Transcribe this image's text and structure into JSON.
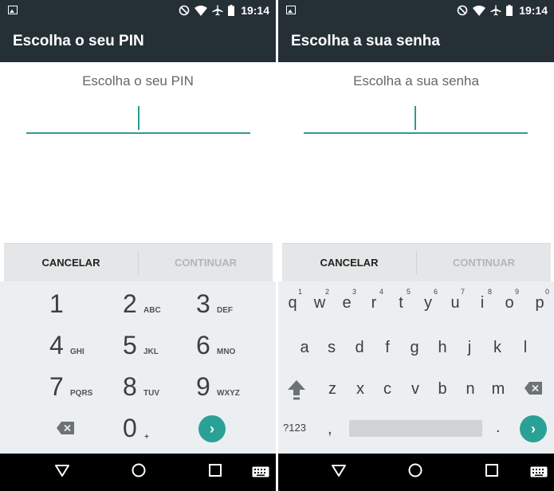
{
  "status_bar": {
    "time": "19:14",
    "icons": [
      "image-icon",
      "do-not-disturb-icon",
      "wifi-icon",
      "airplane-icon",
      "battery-icon"
    ]
  },
  "colors": {
    "bar": "#253036",
    "accent": "#2a9d8f",
    "keyboard": "#eceff1"
  },
  "left": {
    "title": "Escolha o seu PIN",
    "prompt": "Escolha o seu PIN",
    "cancel_label": "CANCELAR",
    "continue_label": "CONTINUAR",
    "numpad": [
      {
        "digit": "1",
        "letters": ""
      },
      {
        "digit": "2",
        "letters": "ABC"
      },
      {
        "digit": "3",
        "letters": "DEF"
      },
      {
        "digit": "4",
        "letters": "GHI"
      },
      {
        "digit": "5",
        "letters": "JKL"
      },
      {
        "digit": "6",
        "letters": "MNO"
      },
      {
        "digit": "7",
        "letters": "PQRS"
      },
      {
        "digit": "8",
        "letters": "TUV"
      },
      {
        "digit": "9",
        "letters": "WXYZ"
      },
      {
        "digit": "0",
        "letters": "+"
      }
    ],
    "enter_icon": "›"
  },
  "right": {
    "title": "Escolha a sua senha",
    "prompt": "Escolha a sua senha",
    "cancel_label": "CANCELAR",
    "continue_label": "CONTINUAR",
    "row1": [
      {
        "letter": "q",
        "hint": "1"
      },
      {
        "letter": "w",
        "hint": "2"
      },
      {
        "letter": "e",
        "hint": "3"
      },
      {
        "letter": "r",
        "hint": "4"
      },
      {
        "letter": "t",
        "hint": "5"
      },
      {
        "letter": "y",
        "hint": "6"
      },
      {
        "letter": "u",
        "hint": "7"
      },
      {
        "letter": "i",
        "hint": "8"
      },
      {
        "letter": "o",
        "hint": "9"
      },
      {
        "letter": "p",
        "hint": "0"
      }
    ],
    "row2": [
      "a",
      "s",
      "d",
      "f",
      "g",
      "h",
      "j",
      "k",
      "l"
    ],
    "row3": [
      "z",
      "x",
      "c",
      "v",
      "b",
      "n",
      "m"
    ],
    "symbols_label": "?123",
    "comma": ",",
    "period": ".",
    "enter_icon": "›"
  }
}
